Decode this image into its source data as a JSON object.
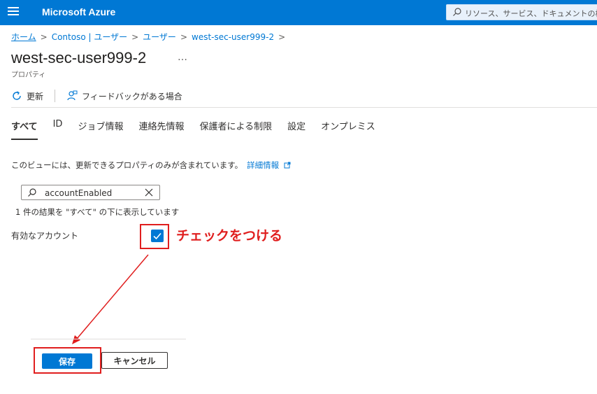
{
  "topbar": {
    "brand": "Microsoft Azure",
    "search_placeholder": "リソース、サービス、ドキュメントの検索 (G",
    "background_color": "#0078d4"
  },
  "breadcrumb": [
    "ホーム",
    "Contoso | ユーザー",
    "ユーザー",
    "west-sec-user999-2"
  ],
  "page": {
    "title": "west-sec-user999-2",
    "more": "…",
    "subtitle": "プロパティ"
  },
  "toolbar": {
    "refresh_label": "更新",
    "feedback_label": "フィードバックがある場合"
  },
  "tabs": [
    "すべて",
    "ID",
    "ジョブ情報",
    "連絡先情報",
    "保護者による制限",
    "設定",
    "オンプレミス"
  ],
  "info": {
    "text": "このビューには、更新できるプロパティのみが含まれています。",
    "link": "詳細情報"
  },
  "filter": {
    "value": "accountEnabled",
    "result_text": "1 件の結果を \"すべて\" の下に表示しています"
  },
  "field": {
    "label": "有効なアカウント",
    "checked": true
  },
  "annotation": {
    "text": "チェックをつける",
    "color": "#e01e1e"
  },
  "footer": {
    "save_label": "保存",
    "cancel_label": "キャンセル"
  }
}
